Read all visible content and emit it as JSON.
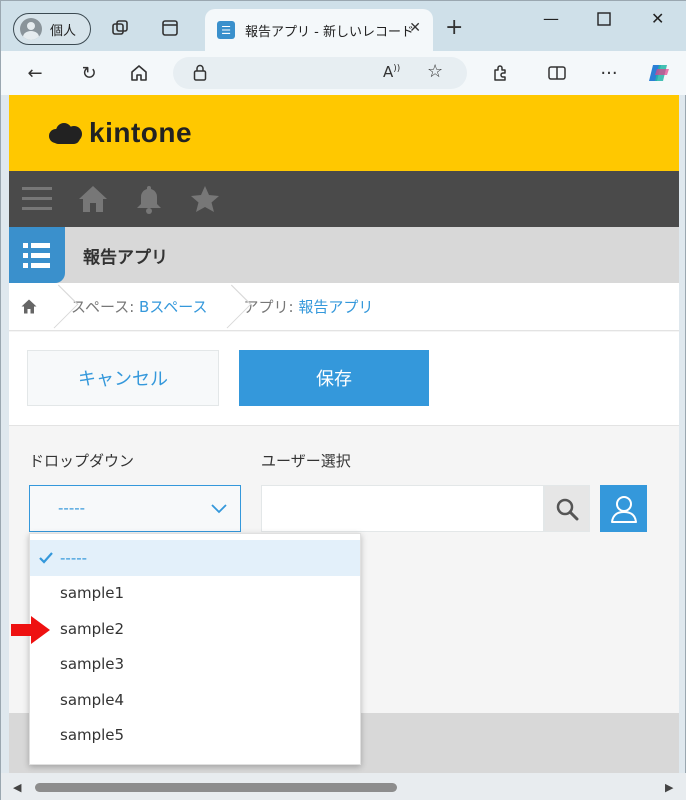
{
  "browser": {
    "profile_label": "個人",
    "tab_title": "報告アプリ - 新しいレコード",
    "tab_icon": "list-icon",
    "url": ""
  },
  "app": {
    "brand": "kintone",
    "app_name": "報告アプリ",
    "colors": {
      "header_yellow": "#ffc800",
      "nav_dark": "#4a4a4a",
      "accent_blue": "#3498db"
    }
  },
  "breadcrumb": {
    "space_prefix": "スペース: ",
    "space_name": "Bスペース",
    "app_prefix": "アプリ: ",
    "app_name": "報告アプリ"
  },
  "actions": {
    "cancel_label": "キャンセル",
    "save_label": "保存"
  },
  "form": {
    "dropdown_label": "ドロップダウン",
    "dropdown_value": "-----",
    "user_select_label": "ユーザー選択",
    "user_select_value": ""
  },
  "dropdown_menu": {
    "options": [
      "-----",
      "sample1",
      "sample2",
      "sample3",
      "sample4",
      "sample5"
    ],
    "selected": "-----",
    "highlighted_by_arrow": "sample2"
  }
}
